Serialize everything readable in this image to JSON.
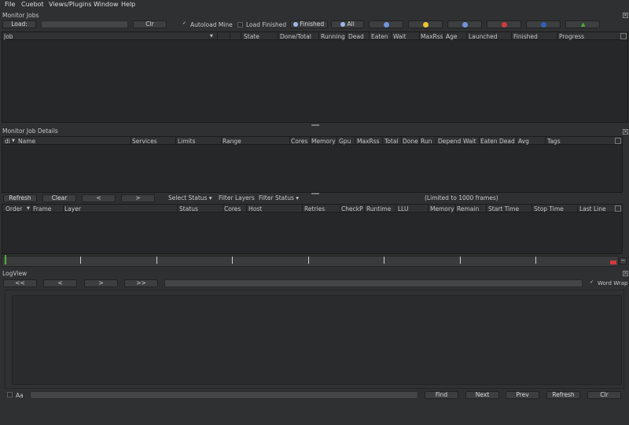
{
  "menubar": {
    "items": [
      "File",
      "Cuebot",
      "Views/Plugins",
      "Window",
      "Help"
    ]
  },
  "monitor_jobs": {
    "title": "Monitor Jobs",
    "load_label": "Load:",
    "clr_label": "Clr",
    "autoload_label": "Autoload Mine",
    "autoload_checked": true,
    "load_finished_label": "Load Finished",
    "finished_label": "Finished",
    "all_label": "All",
    "columns": [
      "Job",
      "State",
      "Done/Total",
      "Running",
      "Dead",
      "Eaten",
      "Wait",
      "MaxRss",
      "Age",
      "Launched",
      "Finished",
      "Progress"
    ]
  },
  "job_details": {
    "title": "Monitor Job Details",
    "layer_columns": [
      "di",
      "Name",
      "Services",
      "Limits",
      "Range",
      "Cores",
      "Memory",
      "Gpu",
      "MaxRss",
      "Total",
      "Done",
      "Run",
      "Depend",
      "Wait",
      "Eaten",
      "Dead",
      "Avg",
      "Tags"
    ],
    "buttons": {
      "refresh": "Refresh",
      "clear": "Clear",
      "prev": "<",
      "next": ">"
    },
    "select_status": "Select Status",
    "filter_layers": "Filter Layers",
    "filter_status": "Filter Status",
    "limit_note": "(Limited to 1000 frames)",
    "frame_columns": [
      "Order",
      "Frame",
      "Layer",
      "Status",
      "Cores",
      "Host",
      "Retries",
      "CheckP",
      "Runtime",
      "LLU",
      "Memory",
      "Remain",
      "Start Time",
      "Stop Time",
      "Last Line"
    ]
  },
  "logview": {
    "title": "LogView",
    "nav": [
      "<<",
      "<",
      ">",
      ">>"
    ],
    "word_wrap_label": "Word Wrap",
    "word_wrap_checked": true,
    "aa_label": "Aa",
    "buttons": [
      "Find",
      "Next",
      "Prev",
      "Refresh",
      "Clr"
    ]
  },
  "colors": {
    "accent_blue": "#5a86d1",
    "warn_yellow": "#e9c531",
    "error_red": "#d13b3b",
    "ok_green": "#4fae3a"
  }
}
